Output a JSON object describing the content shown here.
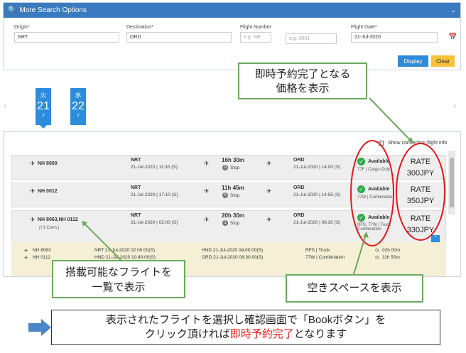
{
  "search_panel": {
    "title": "More Search Options",
    "collapse_icon": "chevron-down-icon",
    "origin": {
      "label": "Origin*",
      "value": "NRT"
    },
    "destination": {
      "label": "Destination*",
      "value": "ORD"
    },
    "flight_number": {
      "label": "Flight Number",
      "placeholder1": "e.g. NH",
      "placeholder2": "e.g. 0001"
    },
    "flight_date": {
      "label": "Flight Date*",
      "value": "21-Jul-2020"
    },
    "display_button": "Display",
    "clear_button": "Clear"
  },
  "date_tabs": [
    {
      "dow": "火",
      "day": "21",
      "count": "7"
    },
    {
      "dow": "水",
      "day": "22",
      "count": "7"
    }
  ],
  "results": {
    "show_connection": "Show connection flight info",
    "rows": [
      {
        "flight": "NH 8000",
        "conn": "",
        "origin": "NRT",
        "dep": "21-Jul-2020 | 11:30 (S)",
        "duration": "16h 30m",
        "stops_count": "0",
        "stops": "Stop",
        "dest": "ORD",
        "arr": "21-Jul-2020 | 14:00 (S)",
        "availability": "Available",
        "avail_sub": "77F | Cargo-Only",
        "rate_label": "RATE",
        "rate_value": "300JPY"
      },
      {
        "flight": "NH 0012",
        "conn": "",
        "origin": "NRT",
        "dep": "21-Jul-2020 | 17:10 (S)",
        "duration": "11h 45m",
        "stops_count": "0",
        "stops": "Stop",
        "dest": "ORD",
        "arr": "21-Jul-2020 | 14:55 (S)",
        "availability": "Available",
        "avail_sub": "77W | Combination",
        "rate_label": "RATE",
        "rate_value": "350JPY"
      },
      {
        "flight": "NH 8063,NH 0112",
        "conn": "(+1 Conn.)",
        "origin": "NRT",
        "dep": "21-Jul-2020 | 02:00 (S)",
        "duration": "20h 30m",
        "stops_count": "1",
        "stops": "Stop",
        "dest": "ORD",
        "arr": "21-Jul-2020 | 08:30 (S)",
        "availability": "Available",
        "avail_sub": "RFS, 77W | Truck Combination",
        "rate_label": "RATE",
        "rate_value": "330JPY"
      }
    ],
    "details": [
      {
        "flight": "NH 8063",
        "from": "NRT 21-Jul-2020 02:00:00(S)",
        "to": "HND 21-Jul-2020 04:00:00(S)",
        "type": "RFS | Truck",
        "time": "02h 00m"
      },
      {
        "flight": "NH 0112",
        "from": "HND 21-Jul-2020 10:40:00(S)",
        "to": "ORD 21-Jul-2020 08:30:00(S)",
        "type": "77W | Combination",
        "time": "11h 50m"
      }
    ]
  },
  "callouts": {
    "top_line1": "即時予約完了となる",
    "top_line2": "価格を表示",
    "left_line1": "搭載可能なフライトを",
    "left_line2": "一覧で表示",
    "right": "空きスペースを表示",
    "bottom_line1": "表示されたフライトを選択し確認画面で「Bookボタン」を",
    "bottom_line2_pre": "クリック頂ければ",
    "bottom_line2_red": "即時予約完了",
    "bottom_line2_post": "となります"
  },
  "colors": {
    "header_blue": "#3a7bbf",
    "tab_blue": "#2c8ddc",
    "callout_green": "#6aaa5a",
    "oval_red": "#e01a1a",
    "arrow_blue": "#4a86c8",
    "detail_bg": "#f5efd5"
  }
}
